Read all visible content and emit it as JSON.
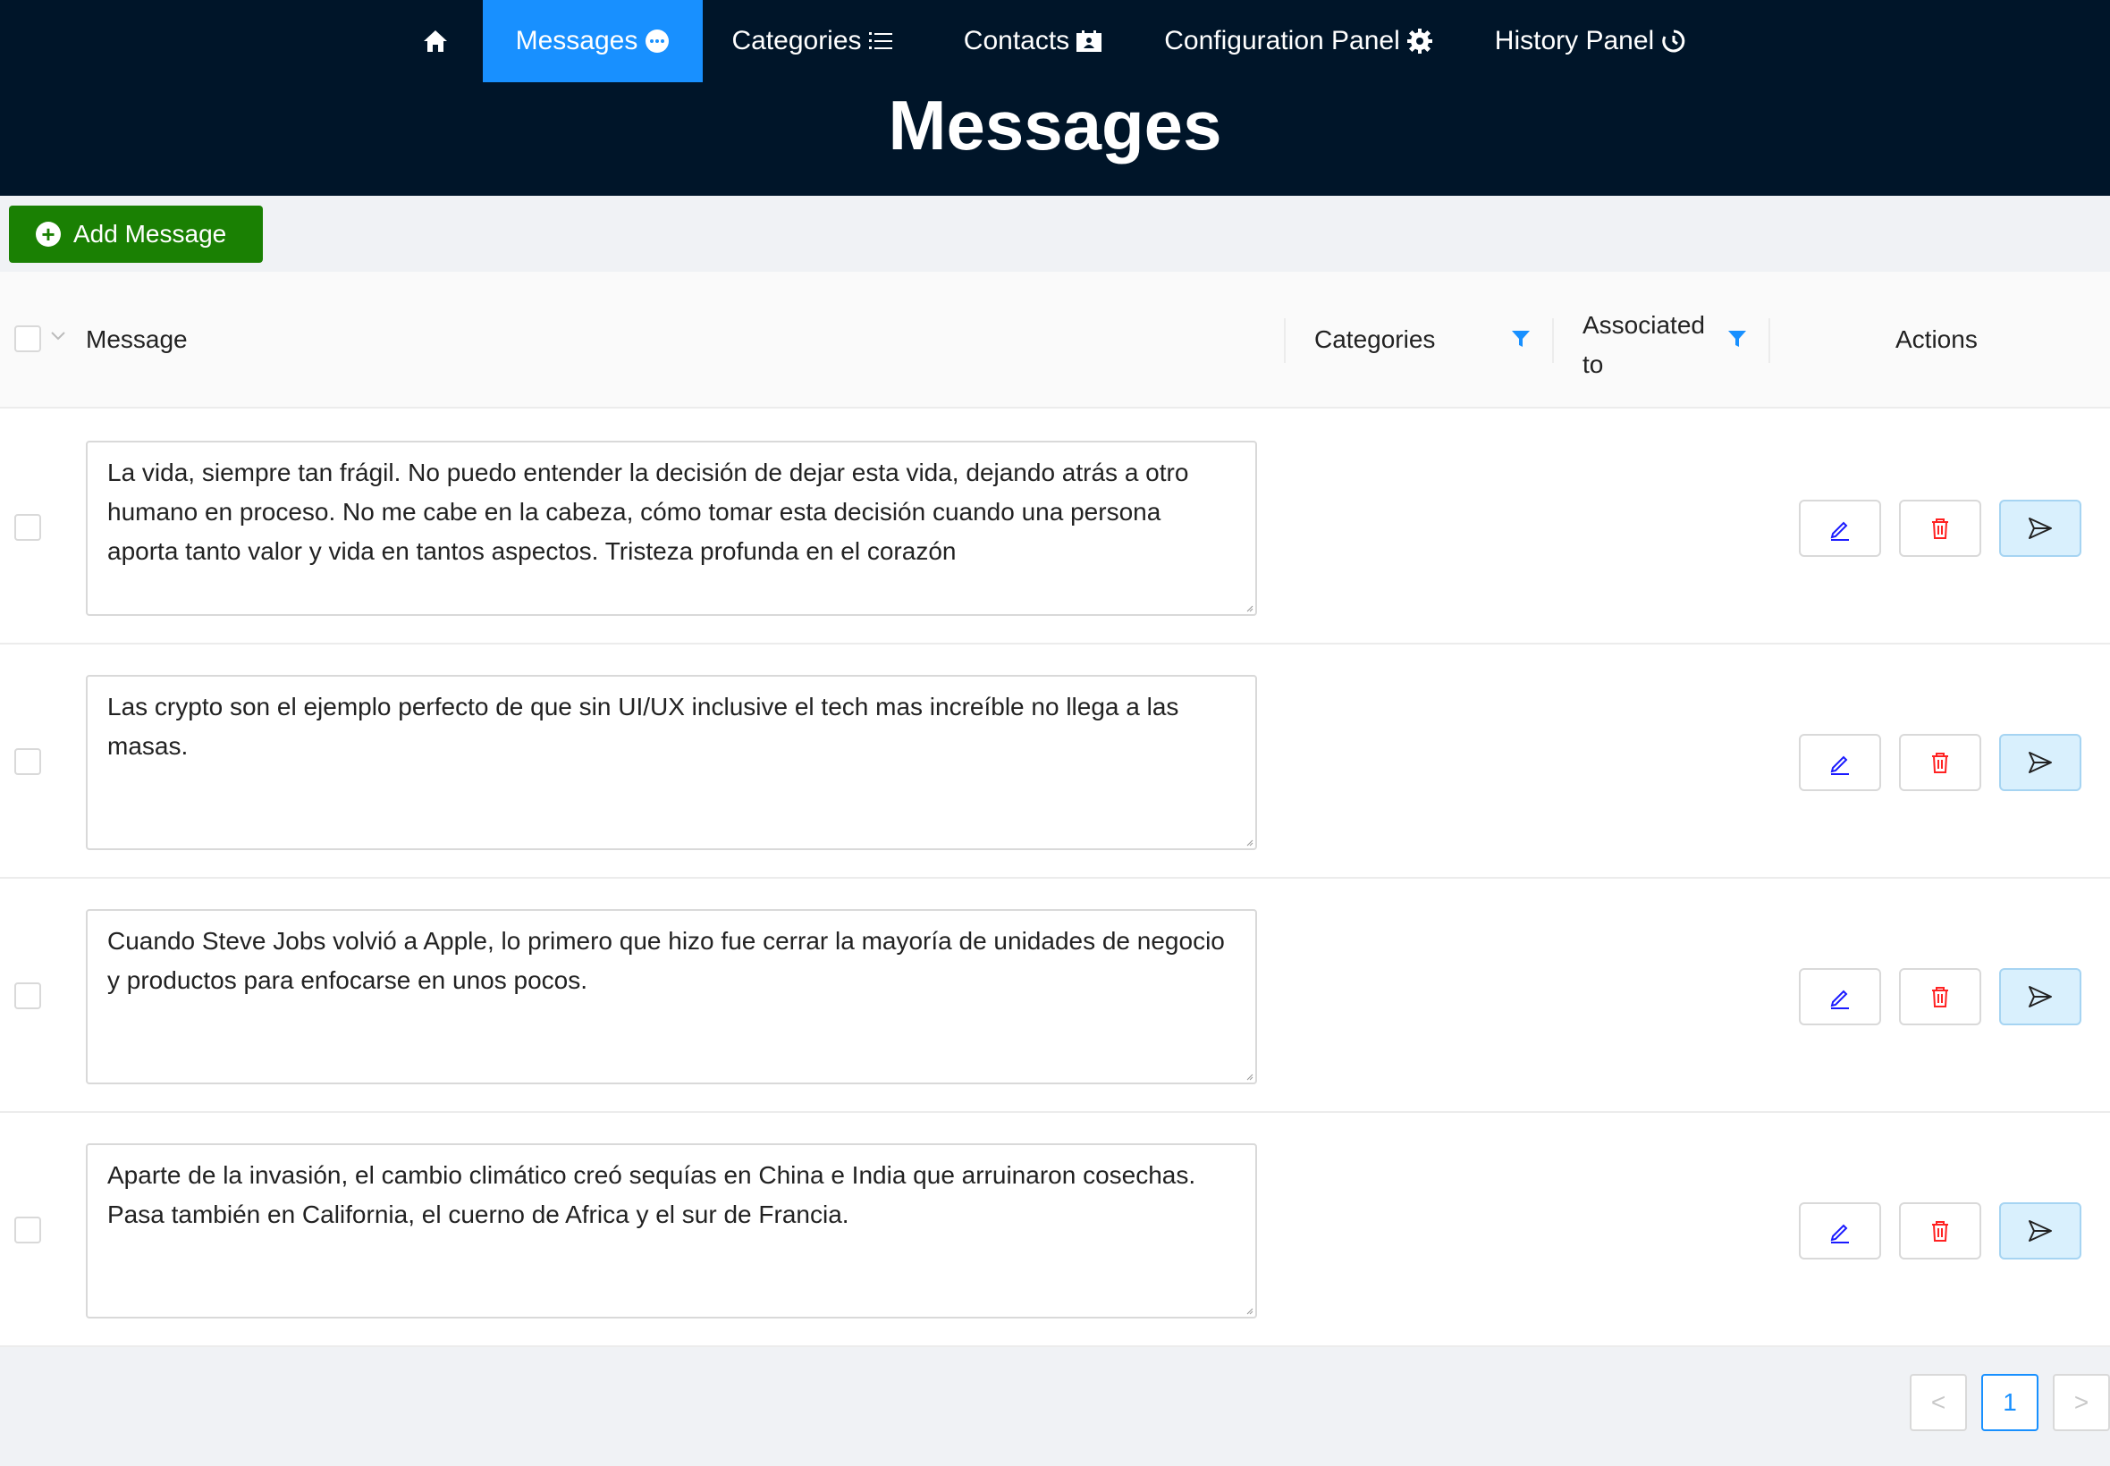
{
  "nav": {
    "home_icon": "home-icon",
    "items": [
      {
        "label": "Messages",
        "icon": "chat-bubble-icon",
        "active": true
      },
      {
        "label": "Categories",
        "icon": "list-icon"
      },
      {
        "label": "Contacts",
        "icon": "contact-card-icon"
      },
      {
        "label": "Configuration Panel",
        "icon": "gear-icon"
      },
      {
        "label": "History Panel",
        "icon": "history-clock-icon"
      }
    ]
  },
  "page_title": "Messages",
  "add_button": {
    "label": "Add Message",
    "icon": "plus-circle-icon"
  },
  "table": {
    "headers": {
      "message": "Message",
      "categories": "Categories",
      "associated_line1": "Associated",
      "associated_line2": "to",
      "actions": "Actions"
    },
    "rows": [
      {
        "message": "La vida, siempre tan frágil. No puedo entender la decisión de dejar esta vida, dejando atrás a otro humano en proceso. No me cabe en la cabeza, cómo tomar esta decisión cuando una persona aporta tanto valor y vida en tantos aspectos. Tristeza profunda en el corazón"
      },
      {
        "message": "Las crypto son el ejemplo perfecto de que sin UI/UX inclusive el tech mas increíble no llega a las masas."
      },
      {
        "message": "Cuando Steve Jobs volvió a Apple, lo primero que hizo fue cerrar la mayoría de unidades de negocio y productos para enfocarse en unos pocos."
      },
      {
        "message": "Aparte de la invasión, el cambio climático creó sequías en China e India que arruinaron cosechas. Pasa también en California, el cuerno de Africa y el sur de Francia."
      }
    ]
  },
  "pagination": {
    "prev": "<",
    "current": "1",
    "next": ">"
  },
  "colors": {
    "header_bg": "#001529",
    "active_nav": "#1890ff",
    "add_button": "#1a8003",
    "edit_icon": "#1a1aff",
    "delete_icon": "#ff2222",
    "send_bg": "#d9f0fd"
  }
}
